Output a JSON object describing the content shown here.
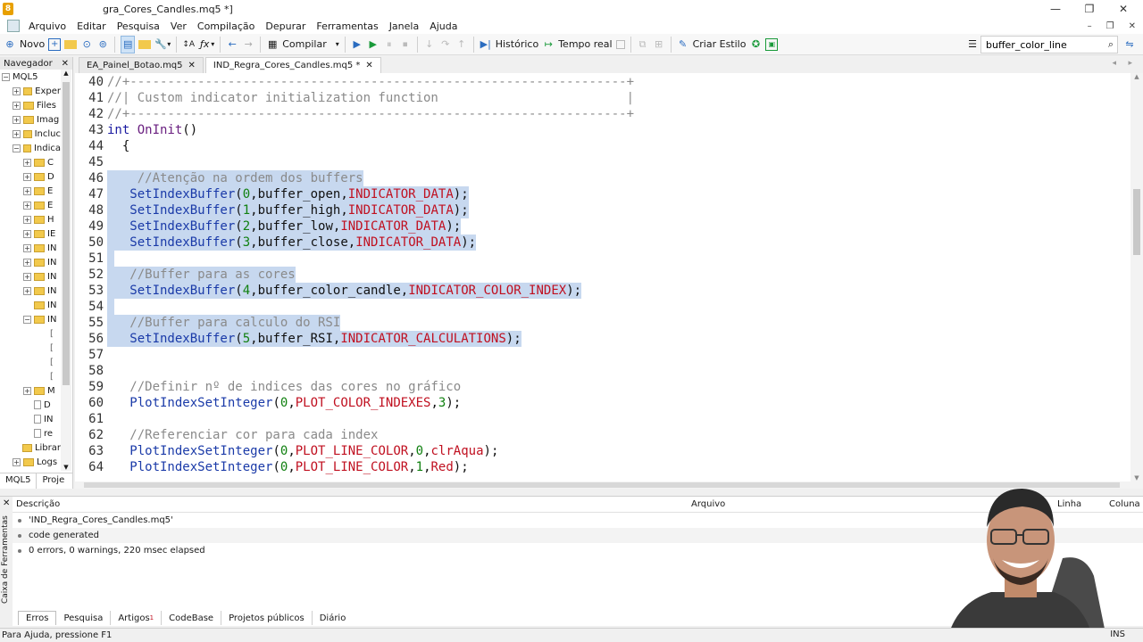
{
  "window": {
    "title": "gra_Cores_Candles.mq5 *]",
    "logo_glyph": "8",
    "minimize": "—",
    "maximize": "❐",
    "close": "✕"
  },
  "menu": {
    "items": [
      "Arquivo",
      "Editar",
      "Pesquisa",
      "Ver",
      "Compilação",
      "Depurar",
      "Ferramentas",
      "Janela",
      "Ajuda"
    ],
    "mdi_min": "–",
    "mdi_restore": "❐",
    "mdi_close": "✕"
  },
  "toolbar": {
    "novo": "Novo",
    "compilar": "Compilar",
    "historico": "Histórico",
    "tempo_real": "Tempo real",
    "criar_estilo": "Criar Estilo",
    "search_value": "buffer_color_line"
  },
  "navigator": {
    "title": "Navegador",
    "close": "✕",
    "root": "MQL5",
    "items": [
      {
        "label": "Exper",
        "type": "folder",
        "level": 1
      },
      {
        "label": "Files",
        "type": "folder",
        "level": 1
      },
      {
        "label": "Imag",
        "type": "folder",
        "level": 1
      },
      {
        "label": "Incluc",
        "type": "folder",
        "level": 1
      },
      {
        "label": "Indica",
        "type": "folder",
        "level": 1,
        "open": true
      },
      {
        "label": "C",
        "type": "folder",
        "level": 2
      },
      {
        "label": "D",
        "type": "folder",
        "level": 2
      },
      {
        "label": "E",
        "type": "folder",
        "level": 2
      },
      {
        "label": "E",
        "type": "folder",
        "level": 2
      },
      {
        "label": "H",
        "type": "folder",
        "level": 2
      },
      {
        "label": "IE",
        "type": "folder",
        "level": 2
      },
      {
        "label": "IN",
        "type": "folder",
        "level": 2
      },
      {
        "label": "IN",
        "type": "folder",
        "level": 2
      },
      {
        "label": "IN",
        "type": "folder",
        "level": 2
      },
      {
        "label": "IN",
        "type": "folder",
        "level": 2
      },
      {
        "label": "IN",
        "type": "folder",
        "level": 2,
        "noexp": true
      },
      {
        "label": "IN",
        "type": "folder",
        "level": 2,
        "open": true
      },
      {
        "label": "",
        "type": "bracket",
        "level": 3
      },
      {
        "label": "",
        "type": "bracket",
        "level": 3
      },
      {
        "label": "",
        "type": "bracket",
        "level": 3
      },
      {
        "label": "",
        "type": "bracket",
        "level": 3
      },
      {
        "label": "M",
        "type": "folder",
        "level": 2
      },
      {
        "label": "D",
        "type": "file",
        "level": 2
      },
      {
        "label": "IN",
        "type": "file",
        "level": 2
      },
      {
        "label": "re",
        "type": "file",
        "level": 2
      },
      {
        "label": "Librar",
        "type": "folder",
        "level": 1,
        "noexp": true
      },
      {
        "label": "Logs",
        "type": "folder",
        "level": 1
      }
    ],
    "tabs": [
      "MQL5",
      "Proje"
    ]
  },
  "editor_tabs": [
    {
      "label": "EA_Painel_Botao.mq5",
      "active": false
    },
    {
      "label": "IND_Regra_Cores_Candles.mq5 *",
      "active": true
    }
  ],
  "code_lines": [
    {
      "n": "40",
      "sel": false,
      "tokens": [
        [
          "c-cm",
          "//+------------------------------------------------------------------+"
        ]
      ]
    },
    {
      "n": "41",
      "sel": false,
      "tokens": [
        [
          "c-cm",
          "//| Custom indicator initialization function                         |"
        ]
      ]
    },
    {
      "n": "42",
      "sel": false,
      "tokens": [
        [
          "c-cm",
          "//+------------------------------------------------------------------+"
        ]
      ]
    },
    {
      "n": "43",
      "sel": false,
      "tokens": [
        [
          "c-kw",
          "int "
        ],
        [
          "c-name",
          "OnInit"
        ],
        [
          "c-id",
          "()"
        ]
      ]
    },
    {
      "n": "44",
      "sel": false,
      "tokens": [
        [
          "c-id",
          "  {"
        ]
      ]
    },
    {
      "n": "45",
      "sel": false,
      "tokens": [
        [
          "c-id",
          ""
        ]
      ]
    },
    {
      "n": "46",
      "sel": true,
      "tokens": [
        [
          "c-cm",
          "    //Atenção na ordem dos buffers"
        ]
      ]
    },
    {
      "n": "47",
      "sel": true,
      "tokens": [
        [
          "c-fn",
          "   SetIndexBuffer"
        ],
        [
          "c-id",
          "("
        ],
        [
          "c-num",
          "0"
        ],
        [
          "c-id",
          ",buffer_open,"
        ],
        [
          "c-cst",
          "INDICATOR_DATA"
        ],
        [
          "c-id",
          ");"
        ]
      ]
    },
    {
      "n": "48",
      "sel": true,
      "tokens": [
        [
          "c-fn",
          "   SetIndexBuffer"
        ],
        [
          "c-id",
          "("
        ],
        [
          "c-num",
          "1"
        ],
        [
          "c-id",
          ",buffer_high,"
        ],
        [
          "c-cst",
          "INDICATOR_DATA"
        ],
        [
          "c-id",
          ");"
        ]
      ]
    },
    {
      "n": "49",
      "sel": true,
      "tokens": [
        [
          "c-fn",
          "   SetIndexBuffer"
        ],
        [
          "c-id",
          "("
        ],
        [
          "c-num",
          "2"
        ],
        [
          "c-id",
          ",buffer_low,"
        ],
        [
          "c-cst",
          "INDICATOR_DATA"
        ],
        [
          "c-id",
          ");"
        ]
      ]
    },
    {
      "n": "50",
      "sel": true,
      "tokens": [
        [
          "c-fn",
          "   SetIndexBuffer"
        ],
        [
          "c-id",
          "("
        ],
        [
          "c-num",
          "3"
        ],
        [
          "c-id",
          ",buffer_close,"
        ],
        [
          "c-cst",
          "INDICATOR_DATA"
        ],
        [
          "c-id",
          ");"
        ]
      ]
    },
    {
      "n": "51",
      "sel": true,
      "tokens": [
        [
          "c-id",
          ""
        ]
      ]
    },
    {
      "n": "52",
      "sel": true,
      "tokens": [
        [
          "c-cm",
          "   //Buffer para as cores"
        ]
      ]
    },
    {
      "n": "53",
      "sel": true,
      "tokens": [
        [
          "c-fn",
          "   SetIndexBuffer"
        ],
        [
          "c-id",
          "("
        ],
        [
          "c-num",
          "4"
        ],
        [
          "c-id",
          ",buffer_color_candle,"
        ],
        [
          "c-cst",
          "INDICATOR_COLOR_INDEX"
        ],
        [
          "c-id",
          ");"
        ]
      ]
    },
    {
      "n": "54",
      "sel": true,
      "tokens": [
        [
          "c-id",
          ""
        ]
      ]
    },
    {
      "n": "55",
      "sel": true,
      "tokens": [
        [
          "c-cm",
          "   //Buffer para calculo do RSI"
        ]
      ]
    },
    {
      "n": "56",
      "sel": true,
      "tokens": [
        [
          "c-fn",
          "   SetIndexBuffer"
        ],
        [
          "c-id",
          "("
        ],
        [
          "c-num",
          "5"
        ],
        [
          "c-id",
          ",buffer_RSI,"
        ],
        [
          "c-cst",
          "INDICATOR_CALCULATIONS"
        ],
        [
          "c-id",
          ");"
        ]
      ]
    },
    {
      "n": "57",
      "sel": false,
      "tokens": [
        [
          "c-id",
          ""
        ]
      ]
    },
    {
      "n": "58",
      "sel": false,
      "tokens": [
        [
          "c-id",
          ""
        ]
      ]
    },
    {
      "n": "59",
      "sel": false,
      "tokens": [
        [
          "c-cm",
          "   //Definir nº de indices das cores no gráfico"
        ]
      ]
    },
    {
      "n": "60",
      "sel": false,
      "tokens": [
        [
          "c-fn",
          "   PlotIndexSetInteger"
        ],
        [
          "c-id",
          "("
        ],
        [
          "c-num",
          "0"
        ],
        [
          "c-id",
          ","
        ],
        [
          "c-cst",
          "PLOT_COLOR_INDEXES"
        ],
        [
          "c-id",
          ","
        ],
        [
          "c-num",
          "3"
        ],
        [
          "c-id",
          ");"
        ]
      ]
    },
    {
      "n": "61",
      "sel": false,
      "tokens": [
        [
          "c-id",
          ""
        ]
      ]
    },
    {
      "n": "62",
      "sel": false,
      "tokens": [
        [
          "c-cm",
          "   //Referenciar cor para cada index"
        ]
      ]
    },
    {
      "n": "63",
      "sel": false,
      "tokens": [
        [
          "c-fn",
          "   PlotIndexSetInteger"
        ],
        [
          "c-id",
          "("
        ],
        [
          "c-num",
          "0"
        ],
        [
          "c-id",
          ","
        ],
        [
          "c-cst",
          "PLOT_LINE_COLOR"
        ],
        [
          "c-id",
          ","
        ],
        [
          "c-num",
          "0"
        ],
        [
          "c-id",
          ","
        ],
        [
          "c-cst",
          "clrAqua"
        ],
        [
          "c-id",
          ");"
        ]
      ]
    },
    {
      "n": "64",
      "sel": false,
      "tokens": [
        [
          "c-fn",
          "   PlotIndexSetInteger"
        ],
        [
          "c-id",
          "("
        ],
        [
          "c-num",
          "0"
        ],
        [
          "c-id",
          ","
        ],
        [
          "c-cst",
          "PLOT_LINE_COLOR"
        ],
        [
          "c-id",
          ","
        ],
        [
          "c-num",
          "1"
        ],
        [
          "c-id",
          ","
        ],
        [
          "c-cst",
          "Red"
        ],
        [
          "c-id",
          ");"
        ]
      ]
    }
  ],
  "toolbox": {
    "close": "✕",
    "side_label": "Caixa de Ferramentas",
    "col_descricao": "Descrição",
    "col_arquivo": "Arquivo",
    "col_linha": "Linha",
    "col_coluna": "Coluna",
    "messages": [
      "'IND_Regra_Cores_Candles.mq5'",
      "code generated",
      "0 errors, 0 warnings, 220 msec elapsed"
    ],
    "tabs": [
      "Erros",
      "Pesquisa",
      "Artigos",
      "CodeBase",
      "Projetos públicos",
      "Diário"
    ],
    "artigos_badge": "1"
  },
  "status": {
    "help": "Para Ajuda, pressione F1",
    "mode": "INS"
  },
  "colors": {
    "selection": "#c7d8ef",
    "comment": "#8a8a8a",
    "function": "#1a3aa8",
    "constant": "#c01020",
    "number": "#108010"
  }
}
